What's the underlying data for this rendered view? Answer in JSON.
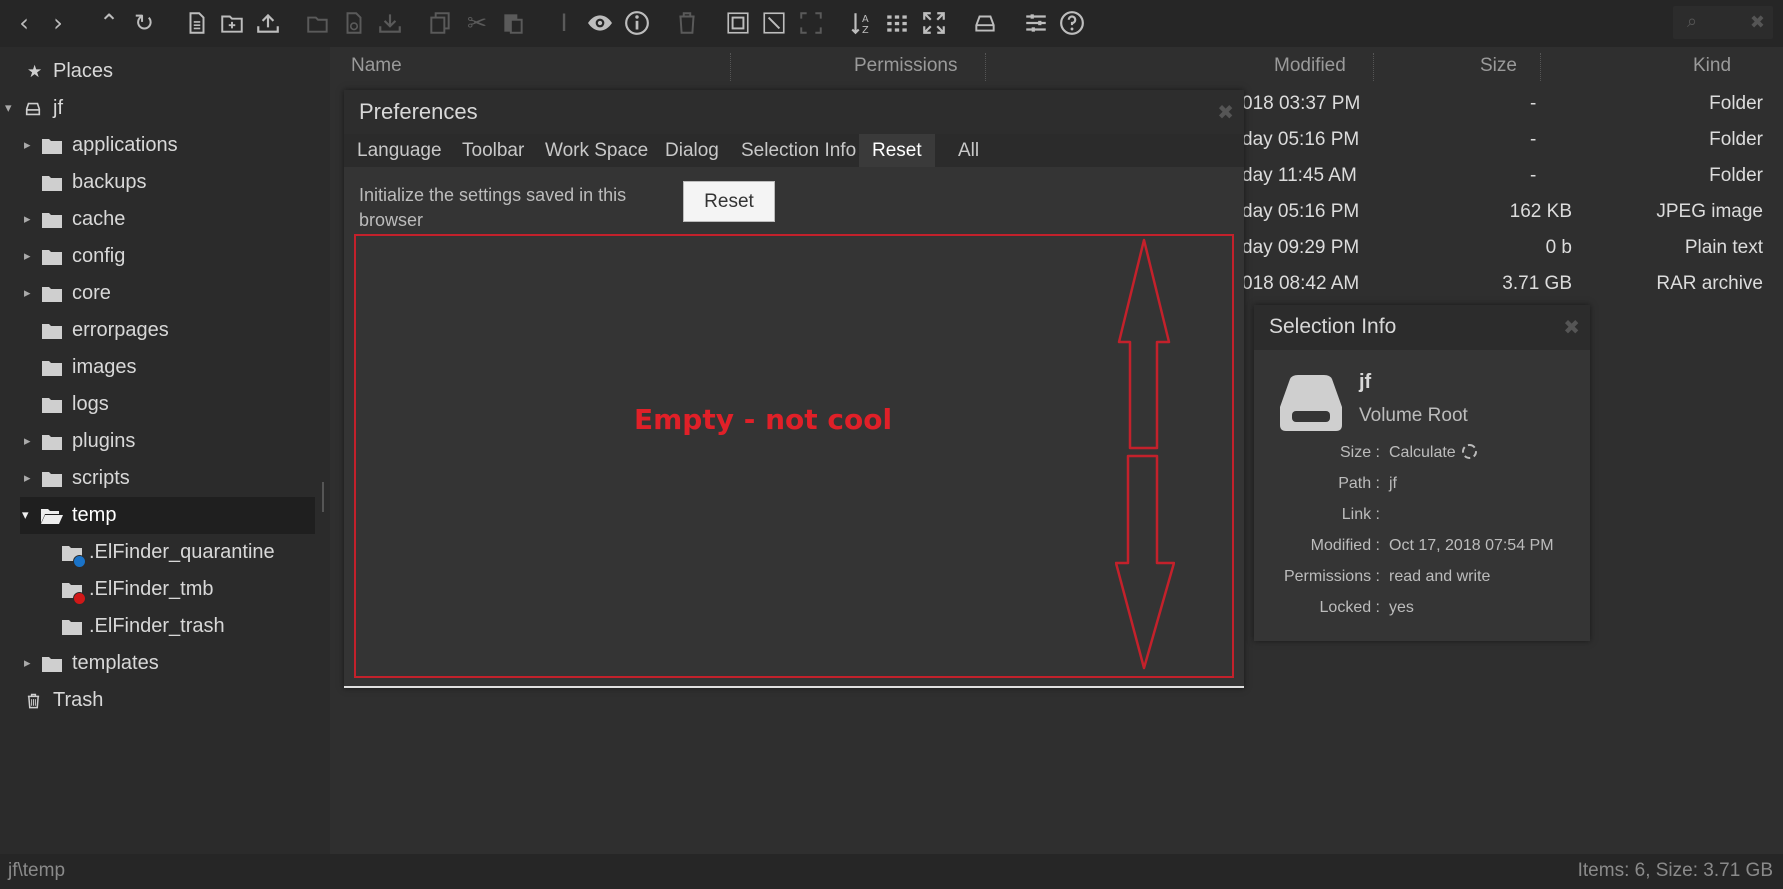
{
  "toolbar": {
    "icons": [
      "back-icon",
      "forward-icon",
      "up-icon",
      "reload-icon",
      "new-file-icon",
      "new-folder-icon",
      "upload-icon",
      "open-icon",
      "open-in-icon",
      "download-icon",
      "copy-icon",
      "cut-icon",
      "paste-icon",
      "rename-icon",
      "preview-icon",
      "info-icon",
      "delete-icon",
      "select-all-icon",
      "select-none-icon",
      "select-invert-icon",
      "sort-icon",
      "view-icon",
      "fullscreen-icon",
      "places-icon",
      "preferences-icon",
      "help-icon"
    ]
  },
  "sidebar": {
    "places": "Places",
    "root": "jf",
    "items": [
      {
        "label": "applications",
        "expandable": true
      },
      {
        "label": "backups",
        "expandable": false
      },
      {
        "label": "cache",
        "expandable": true
      },
      {
        "label": "config",
        "expandable": true
      },
      {
        "label": "core",
        "expandable": true
      },
      {
        "label": "errorpages",
        "expandable": false
      },
      {
        "label": "images",
        "expandable": false
      },
      {
        "label": "logs",
        "expandable": false
      },
      {
        "label": "plugins",
        "expandable": true
      },
      {
        "label": "scripts",
        "expandable": true
      },
      {
        "label": "temp",
        "expandable": true,
        "open": true
      },
      {
        "label": ".ElFinder_quarantine",
        "badge": "#1a73c8"
      },
      {
        "label": ".ElFinder_tmb",
        "badge": "#d01818"
      },
      {
        "label": ".ElFinder_trash"
      },
      {
        "label": "templates",
        "expandable": true
      }
    ],
    "trash": "Trash"
  },
  "columns": {
    "name": "Name",
    "permissions": "Permissions",
    "modified": "Modified",
    "size": "Size",
    "kind": "Kind"
  },
  "files": [
    {
      "modified": "018 03:37 PM",
      "size": "-",
      "kind": "Folder"
    },
    {
      "modified": "day 05:16 PM",
      "size": "-",
      "kind": "Folder"
    },
    {
      "modified": "day 11:45 AM",
      "size": "-",
      "kind": "Folder"
    },
    {
      "modified": "day 05:16 PM",
      "size": "162 KB",
      "kind": "JPEG image"
    },
    {
      "modified": "day 09:29 PM",
      "size": "0 b",
      "kind": "Plain text"
    },
    {
      "modified": "018 08:42 AM",
      "size": "3.71 GB",
      "kind": "RAR archive"
    }
  ],
  "preferences": {
    "title": "Preferences",
    "tabs": [
      "Language",
      "Toolbar",
      "Work Space",
      "Dialog",
      "Selection Info",
      "Reset",
      "All"
    ],
    "active_tab": "Reset",
    "description": "Initialize the settings saved in this browser",
    "reset_label": "Reset",
    "annotation": "Empty - not cool",
    "annotation_color": "#e02028"
  },
  "selection_info": {
    "title": "Selection Info",
    "name": "jf",
    "kind": "Volume Root",
    "rows": [
      {
        "key": "Size :",
        "value": "Calculate"
      },
      {
        "key": "Path :",
        "value": "jf"
      },
      {
        "key": "Link :",
        "value": ""
      },
      {
        "key": "Modified :",
        "value": "Oct 17, 2018 07:54 PM"
      },
      {
        "key": "Permissions :",
        "value": "read and write"
      },
      {
        "key": "Locked :",
        "value": "yes"
      }
    ]
  },
  "status": {
    "path": "jf\\temp",
    "summary": "Items: 6, Size: 3.71 GB"
  }
}
